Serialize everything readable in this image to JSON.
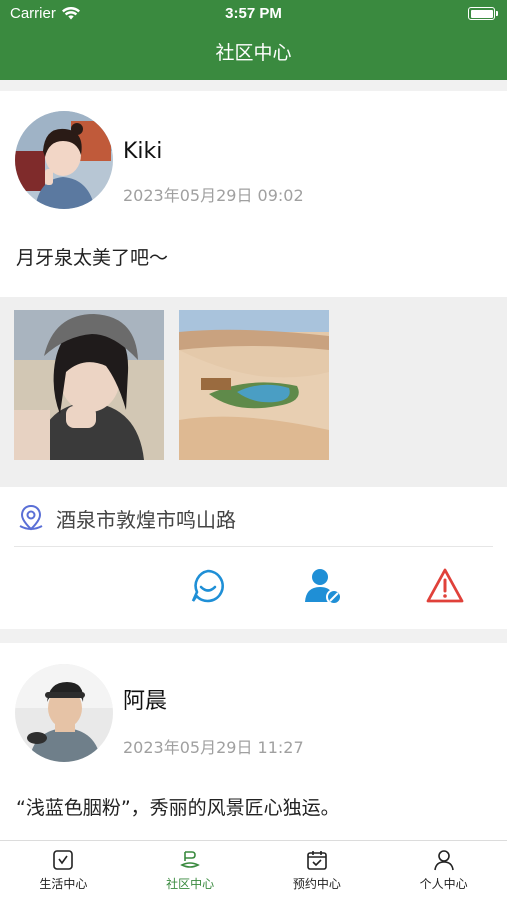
{
  "status_bar": {
    "carrier": "Carrier",
    "time": "3:57 PM"
  },
  "header": {
    "title": "社区中心"
  },
  "posts": [
    {
      "username": "Kiki",
      "datetime": "2023年05月29日 09:02",
      "text": "月牙泉太美了吧～",
      "location": "酒泉市敦煌市鸣山路",
      "icons": {
        "comment": "comment-icon",
        "follow": "user-follow-icon",
        "report": "warning-icon"
      },
      "colors": {
        "comment": "#1f8fd6",
        "follow": "#1f8fd6",
        "report": "#e0413a"
      }
    },
    {
      "username": "阿晨",
      "datetime": "2023年05月29日 11:27",
      "text": "“浅蓝色胭粉”，秀丽的风景匠心独运。"
    }
  ],
  "tabs": [
    {
      "label": "生活中心",
      "icon": "life-icon"
    },
    {
      "label": "社区中心",
      "icon": "community-icon",
      "active": true
    },
    {
      "label": "预约中心",
      "icon": "calendar-icon"
    },
    {
      "label": "个人中心",
      "icon": "person-icon"
    }
  ],
  "colors": {
    "brand": "#3a8a3f",
    "background": "#f1f1f1"
  }
}
